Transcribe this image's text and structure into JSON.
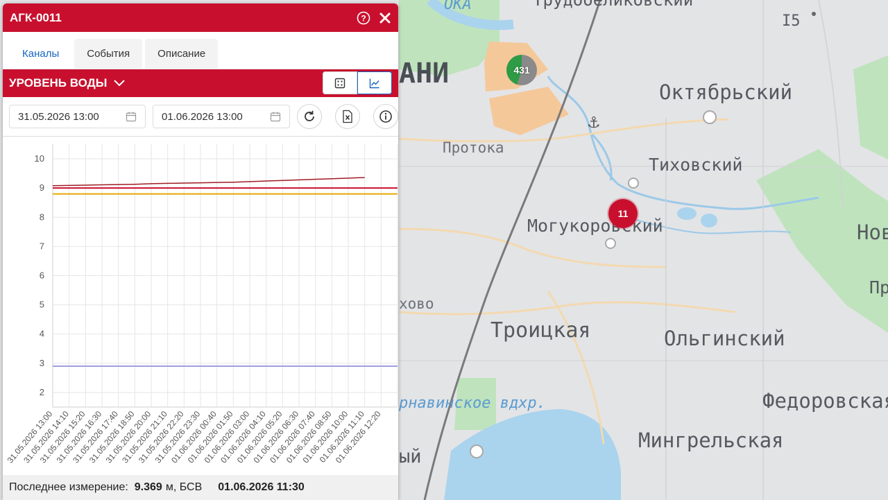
{
  "panel": {
    "title": "АГК-0011",
    "tabs": [
      {
        "label": "Каналы",
        "active": true
      },
      {
        "label": "События",
        "active": false
      },
      {
        "label": "Описание",
        "active": false
      }
    ],
    "channel": {
      "label": "УРОВЕНЬ ВОДЫ"
    },
    "date_from": "31.05.2026 13:00",
    "date_to": "01.06.2026 13:00",
    "status": {
      "prefix": "Последнее измерение:",
      "value": "9.369",
      "unit": "м, БСВ",
      "timestamp": "01.06.2026 11:30"
    }
  },
  "map": {
    "labels": {
      "ani": "АНИ",
      "oka": "ОКА",
      "trud": "Трудобеликовский",
      "i5": "I5",
      "oktyabrsky": "Октябрьский",
      "protoka": "Протока",
      "tikhovsky": "Тиховский",
      "mogukorovsky": "Могукоровский",
      "novo": "Нов",
      "pr": "Пр",
      "khovo": "хово",
      "troitskaya": "Троицкая",
      "olginsky": "Ольгинский",
      "reservoir": "рнавинское вдхр.",
      "fedorovskaya": "Федоровская",
      "mingrelskaya": "Мингрельская",
      "yy": "ый"
    },
    "clusters": [
      {
        "label": "431",
        "color": "#2e9b45"
      },
      {
        "label": "11",
        "color": "#c8102e"
      }
    ]
  },
  "chart_data": {
    "type": "line",
    "ylim": [
      1.5,
      10.5
    ],
    "yticks": [
      2,
      3,
      4,
      5,
      6,
      7,
      8,
      9,
      10
    ],
    "categories": [
      "31.05.2026 13:00",
      "31.05.2026 14:10",
      "31.05.2026 15:20",
      "31.05.2026 16:30",
      "31.05.2026 17:40",
      "31.05.2026 18:50",
      "31.05.2026 20:00",
      "31.05.2026 21:10",
      "31.05.2026 22:20",
      "31.05.2026 23:30",
      "01.06.2026 00:40",
      "01.06.2026 01:50",
      "01.06.2026 03:00",
      "01.06.2026 04:10",
      "01.06.2026 05:20",
      "01.06.2026 06:30",
      "01.06.2026 07:40",
      "01.06.2026 08:50",
      "01.06.2026 10:00",
      "01.06.2026 11:10",
      "01.06.2026 12:20"
    ],
    "series": [
      {
        "color": "#a01c24",
        "values": [
          9.08,
          9.09,
          9.1,
          9.11,
          9.12,
          9.13,
          9.15,
          9.16,
          9.17,
          9.18,
          9.19,
          9.2,
          9.22,
          9.24,
          9.26,
          9.28,
          9.3,
          9.32,
          9.34,
          9.36
        ]
      }
    ],
    "thresholds": [
      {
        "value": 9.0,
        "color": "#c8102e"
      },
      {
        "value": 8.8,
        "color": "#e6a800"
      },
      {
        "value": 2.9,
        "color": "#9e9ee0"
      }
    ],
    "grid": true
  }
}
